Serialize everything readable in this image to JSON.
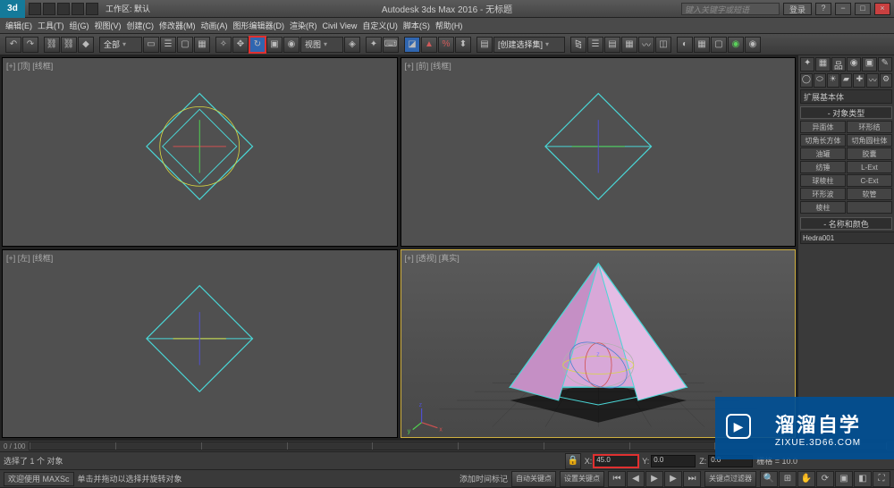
{
  "titlebar": {
    "workspace": "工作区: 默认",
    "app_title": "Autodesk 3ds Max 2016 - 无标题",
    "search_placeholder": "键入关键字或短语",
    "login_label": "登录"
  },
  "menubar": {
    "items": [
      "编辑(E)",
      "工具(T)",
      "组(G)",
      "视图(V)",
      "创建(C)",
      "修改器(M)",
      "动画(A)",
      "图形编辑器(D)",
      "渲染(R)",
      "Civil View",
      "自定义(U)",
      "脚本(S)",
      "帮助(H)"
    ]
  },
  "toolbar": {
    "dropdown1": "全部",
    "dropdown2": "视图",
    "dropdown3": "[创建选择集]"
  },
  "viewports": {
    "top": "[+] [顶] [线框]",
    "front": "[+] [前] [线框]",
    "left": "[+] [左] [线框]",
    "perspective": "[+] [透视] [真实]"
  },
  "command_panel": {
    "dropdown": "扩展基本体",
    "rollout1": "- 对象类型",
    "types": [
      "异面体",
      "环形结",
      "切角长方体",
      "切角圆柱体",
      "油罐",
      "胶囊",
      "纺锤",
      "L-Ext",
      "球棱柱",
      "C-Ext",
      "环形波",
      "软管",
      "棱柱",
      ""
    ],
    "rollout2": "- 名称和颜色",
    "object_name": "Hedra001"
  },
  "timeline": {
    "range": "0 / 100"
  },
  "status": {
    "selection": "选择了 1 个 对象",
    "welcome": "欢迎使用 MAXSc",
    "prompt": "单击并拖动以选择并旋转对象",
    "add_time_tag": "添加时间标记",
    "auto_key": "自动关键点",
    "set_key": "设置关键点",
    "x": "45.0",
    "y": "0.0",
    "z": "0.0",
    "grid": "栅格 = 10.0",
    "key_filters": "关键点过滤器"
  },
  "watermark": {
    "big": "溜溜自学",
    "small": "ZIXUE.3D66.COM"
  }
}
